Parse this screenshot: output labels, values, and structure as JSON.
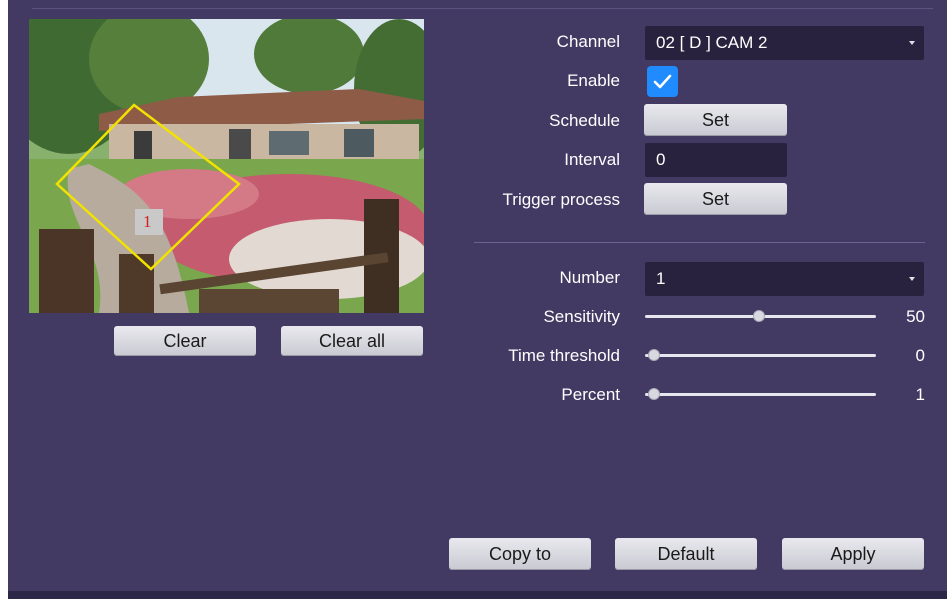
{
  "preview": {
    "region_label": "1",
    "clear_label": "Clear",
    "clear_all_label": "Clear all"
  },
  "settings": {
    "channel": {
      "label": "Channel",
      "value": "02 [ D ] CAM 2"
    },
    "enable": {
      "label": "Enable",
      "checked": true
    },
    "schedule": {
      "label": "Schedule",
      "button": "Set"
    },
    "interval": {
      "label": "Interval",
      "value": "0"
    },
    "trigger": {
      "label": "Trigger process",
      "button": "Set"
    }
  },
  "region": {
    "number": {
      "label": "Number",
      "value": "1"
    },
    "sensitivity": {
      "label": "Sensitivity",
      "value": "50",
      "fraction": 0.5
    },
    "time_threshold": {
      "label": "Time threshold",
      "value": "0",
      "fraction": 0.0
    },
    "percent": {
      "label": "Percent",
      "value": "1",
      "fraction": 0.01
    }
  },
  "footer": {
    "copy_label": "Copy to",
    "default_label": "Default",
    "apply_label": "Apply"
  },
  "colors": {
    "panel": "#423a63",
    "input_dark": "#28223f",
    "accent_check": "#1f8bff",
    "region_outline": "#f2e200"
  }
}
